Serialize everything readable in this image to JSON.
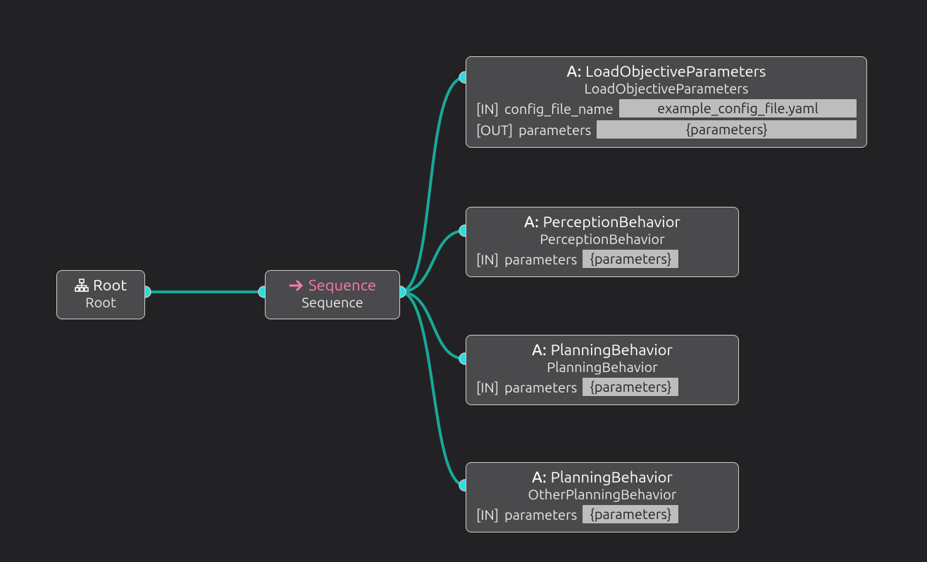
{
  "colors": {
    "background": "#222224",
    "node_bg": "#4a4a4d",
    "node_border": "#cfcfcf",
    "edge": "#18a99a",
    "port": "#2bdde0",
    "seq_accent": "#ff7aa8",
    "value_bg": "#bdbdbd",
    "value_fg": "#242424"
  },
  "nodes": {
    "root": {
      "title": "Root",
      "subtitle": "Root"
    },
    "sequence": {
      "title": "Sequence",
      "subtitle": "Sequence"
    },
    "load_objective": {
      "action_prefix": "A:",
      "title": "LoadObjectiveParameters",
      "subtitle": "LoadObjectiveParameters",
      "ports": [
        {
          "dir": "[IN]",
          "key": "config_file_name",
          "value": "example_config_file.yaml"
        },
        {
          "dir": "[OUT]",
          "key": "parameters",
          "value": "{parameters}"
        }
      ]
    },
    "perception": {
      "action_prefix": "A:",
      "title": "PerceptionBehavior",
      "subtitle": "PerceptionBehavior",
      "ports": [
        {
          "dir": "[IN]",
          "key": "parameters",
          "value": "{parameters}"
        }
      ]
    },
    "planning1": {
      "action_prefix": "A:",
      "title": "PlanningBehavior",
      "subtitle": "PlanningBehavior",
      "ports": [
        {
          "dir": "[IN]",
          "key": "parameters",
          "value": "{parameters}"
        }
      ]
    },
    "planning2": {
      "action_prefix": "A:",
      "title": "PlanningBehavior",
      "subtitle": "OtherPlanningBehavior",
      "ports": [
        {
          "dir": "[IN]",
          "key": "parameters",
          "value": "{parameters}"
        }
      ]
    }
  },
  "edges": [
    {
      "from": "root",
      "to": "sequence"
    },
    {
      "from": "sequence",
      "to": "load_objective"
    },
    {
      "from": "sequence",
      "to": "perception"
    },
    {
      "from": "sequence",
      "to": "planning1"
    },
    {
      "from": "sequence",
      "to": "planning2"
    }
  ]
}
